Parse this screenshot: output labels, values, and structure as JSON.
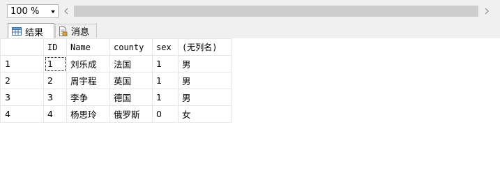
{
  "toolbar": {
    "zoom_value": "100 %"
  },
  "tabs": {
    "results_label": "结果",
    "messages_label": "消息"
  },
  "grid": {
    "columns": [
      "ID",
      "Name",
      "county",
      "sex",
      "(无列名)"
    ],
    "rows": [
      {
        "rownum": "1",
        "id": "1",
        "name": "刘乐成",
        "county": "法国",
        "sex": "1",
        "nocol": "男"
      },
      {
        "rownum": "2",
        "id": "2",
        "name": "周宇程",
        "county": "英国",
        "sex": "1",
        "nocol": "男"
      },
      {
        "rownum": "3",
        "id": "3",
        "name": "李争",
        "county": "德国",
        "sex": "1",
        "nocol": "男"
      },
      {
        "rownum": "4",
        "id": "4",
        "name": "杨思玲",
        "county": "俄罗斯",
        "sex": "0",
        "nocol": "女"
      }
    ]
  },
  "icons": {
    "results_tab": "grid-icon",
    "messages_tab": "document-icon",
    "zoom_dropdown": "chevron-down-icon",
    "scroll_left": "chevron-left-icon",
    "scroll_right": "chevron-right-icon"
  }
}
